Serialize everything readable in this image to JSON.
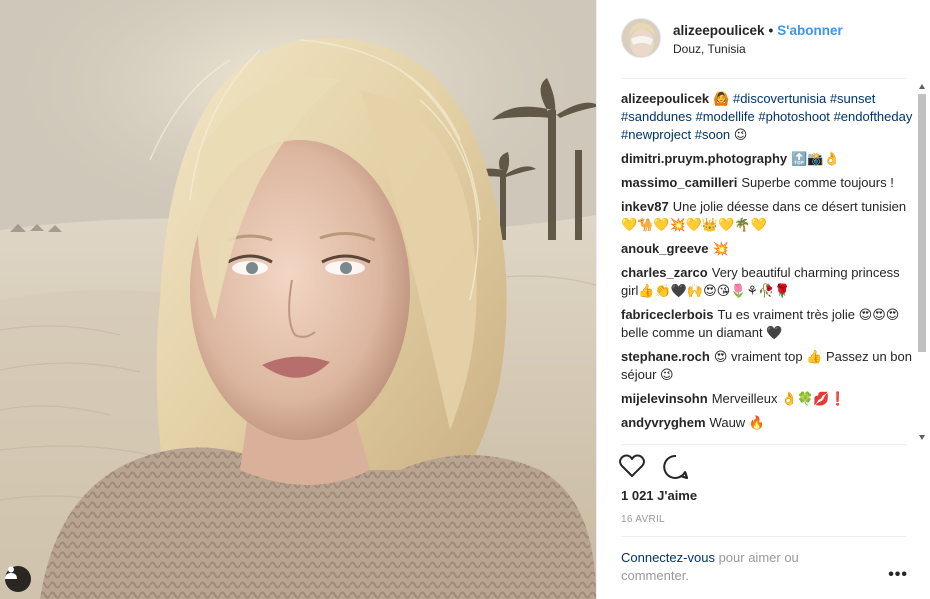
{
  "post": {
    "username": "alizeepoulicek",
    "separator": "•",
    "follow_label": "S'abonner",
    "location": "Douz, Tunisia",
    "caption_emoji": "🙆",
    "caption_tags": [
      "#discovertunisia",
      "#sunset",
      "#sanddunes",
      "#modellife",
      "#photoshoot",
      "#endoftheday",
      "#newproject",
      "#soon"
    ],
    "caption_end_emoji": "😉",
    "likes": "1 021 J'aime",
    "date": "16 AVRIL",
    "login_link": "Connectez-vous",
    "login_text": " pour aimer ou commenter.",
    "more_label": "•••"
  },
  "comments": [
    {
      "user": "dimitri.pruym.photography",
      "text": "",
      "emoji": "🔝📸👌"
    },
    {
      "user": "massimo_camilleri",
      "text": "Superbe comme toujours !",
      "emoji": ""
    },
    {
      "user": "inkev87",
      "text": "Une jolie déesse dans ce désert tunisien ",
      "emoji": "💛🐪💛💥💛👑💛🌴💛"
    },
    {
      "user": "anouk_greeve",
      "text": "",
      "emoji": "💥"
    },
    {
      "user": "charles_zarco",
      "text": "Very beautiful charming princess girl",
      "emoji": "👍👏🖤🙌😍😘🌷⚘🥀🌹"
    },
    {
      "user": "fabriceclerbois",
      "text": "Tu es vraiment très jolie ",
      "emoji": "😍",
      "text2": "belle comme un diamant ",
      "emoji_pre2": "😍😍",
      "emoji2": "🖤"
    },
    {
      "user": "stephane.roch",
      "text": "",
      "emoji": "😍",
      "text2": " vraiment top ",
      "emoji2": "👍",
      "text3": " Passez un bon séjour ",
      "emoji3": "😉"
    },
    {
      "user": "mijelevinsohn",
      "text": "Merveilleux ",
      "emoji": "👌🍀💋❗"
    },
    {
      "user": "andyvryghem",
      "text": "Wauw ",
      "emoji": "🔥"
    }
  ],
  "icons": [
    "heart-icon",
    "comment-icon",
    "person-tag-icon"
  ]
}
